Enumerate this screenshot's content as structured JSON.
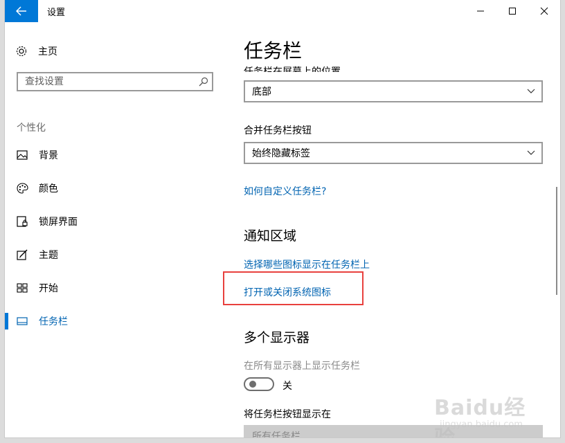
{
  "window": {
    "title": "设置"
  },
  "sidebar": {
    "home_label": "主页",
    "search_placeholder": "查找设置",
    "section_label": "个性化",
    "items": [
      {
        "label": "背景",
        "icon": "picture-icon"
      },
      {
        "label": "颜色",
        "icon": "palette-icon"
      },
      {
        "label": "锁屏界面",
        "icon": "lock-screen-icon"
      },
      {
        "label": "主题",
        "icon": "theme-icon"
      },
      {
        "label": "开始",
        "icon": "start-icon"
      },
      {
        "label": "任务栏",
        "icon": "taskbar-icon",
        "selected": true
      }
    ]
  },
  "main": {
    "page_title": "任务栏",
    "position_label": "任务栏在屏幕上的位置",
    "position_value": "底部",
    "combine_label": "合并任务栏按钮",
    "combine_value": "始终隐藏标签",
    "customize_link": "如何自定义任务栏?",
    "notification_heading": "通知区域",
    "select_icons_link": "选择哪些图标显示在任务栏上",
    "system_icons_link": "打开或关闭系统图标",
    "multi_display_heading": "多个显示器",
    "show_all_label": "在所有显示器上显示任务栏",
    "toggle_state": "关",
    "show_buttons_label": "将任务栏按钮显示在",
    "show_buttons_value": "所有任务栏"
  },
  "watermark": {
    "main": "Baidu经验",
    "sub": "jingyan.baidu.com"
  },
  "colors": {
    "accent": "#0078d7",
    "link": "#0063b1",
    "highlight": "#e8403d"
  }
}
